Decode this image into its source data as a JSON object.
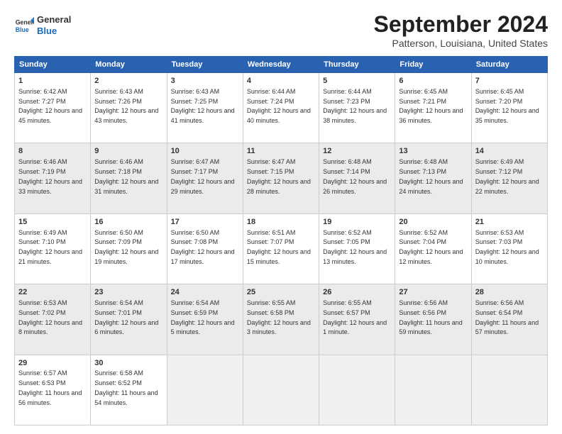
{
  "header": {
    "logo": {
      "general": "General",
      "blue": "Blue"
    },
    "title": "September 2024",
    "subtitle": "Patterson, Louisiana, United States"
  },
  "calendar": {
    "days_of_week": [
      "Sunday",
      "Monday",
      "Tuesday",
      "Wednesday",
      "Thursday",
      "Friday",
      "Saturday"
    ],
    "rows": [
      [
        {
          "date": "1",
          "rise": "6:42 AM",
          "set": "7:27 PM",
          "daylight": "12 hours and 45 minutes."
        },
        {
          "date": "2",
          "rise": "6:43 AM",
          "set": "7:26 PM",
          "daylight": "12 hours and 43 minutes."
        },
        {
          "date": "3",
          "rise": "6:43 AM",
          "set": "7:25 PM",
          "daylight": "12 hours and 41 minutes."
        },
        {
          "date": "4",
          "rise": "6:44 AM",
          "set": "7:24 PM",
          "daylight": "12 hours and 40 minutes."
        },
        {
          "date": "5",
          "rise": "6:44 AM",
          "set": "7:23 PM",
          "daylight": "12 hours and 38 minutes."
        },
        {
          "date": "6",
          "rise": "6:45 AM",
          "set": "7:21 PM",
          "daylight": "12 hours and 36 minutes."
        },
        {
          "date": "7",
          "rise": "6:45 AM",
          "set": "7:20 PM",
          "daylight": "12 hours and 35 minutes."
        }
      ],
      [
        {
          "date": "8",
          "rise": "6:46 AM",
          "set": "7:19 PM",
          "daylight": "12 hours and 33 minutes."
        },
        {
          "date": "9",
          "rise": "6:46 AM",
          "set": "7:18 PM",
          "daylight": "12 hours and 31 minutes."
        },
        {
          "date": "10",
          "rise": "6:47 AM",
          "set": "7:17 PM",
          "daylight": "12 hours and 29 minutes."
        },
        {
          "date": "11",
          "rise": "6:47 AM",
          "set": "7:15 PM",
          "daylight": "12 hours and 28 minutes."
        },
        {
          "date": "12",
          "rise": "6:48 AM",
          "set": "7:14 PM",
          "daylight": "12 hours and 26 minutes."
        },
        {
          "date": "13",
          "rise": "6:48 AM",
          "set": "7:13 PM",
          "daylight": "12 hours and 24 minutes."
        },
        {
          "date": "14",
          "rise": "6:49 AM",
          "set": "7:12 PM",
          "daylight": "12 hours and 22 minutes."
        }
      ],
      [
        {
          "date": "15",
          "rise": "6:49 AM",
          "set": "7:10 PM",
          "daylight": "12 hours and 21 minutes."
        },
        {
          "date": "16",
          "rise": "6:50 AM",
          "set": "7:09 PM",
          "daylight": "12 hours and 19 minutes."
        },
        {
          "date": "17",
          "rise": "6:50 AM",
          "set": "7:08 PM",
          "daylight": "12 hours and 17 minutes."
        },
        {
          "date": "18",
          "rise": "6:51 AM",
          "set": "7:07 PM",
          "daylight": "12 hours and 15 minutes."
        },
        {
          "date": "19",
          "rise": "6:52 AM",
          "set": "7:05 PM",
          "daylight": "12 hours and 13 minutes."
        },
        {
          "date": "20",
          "rise": "6:52 AM",
          "set": "7:04 PM",
          "daylight": "12 hours and 12 minutes."
        },
        {
          "date": "21",
          "rise": "6:53 AM",
          "set": "7:03 PM",
          "daylight": "12 hours and 10 minutes."
        }
      ],
      [
        {
          "date": "22",
          "rise": "6:53 AM",
          "set": "7:02 PM",
          "daylight": "12 hours and 8 minutes."
        },
        {
          "date": "23",
          "rise": "6:54 AM",
          "set": "7:01 PM",
          "daylight": "12 hours and 6 minutes."
        },
        {
          "date": "24",
          "rise": "6:54 AM",
          "set": "6:59 PM",
          "daylight": "12 hours and 5 minutes."
        },
        {
          "date": "25",
          "rise": "6:55 AM",
          "set": "6:58 PM",
          "daylight": "12 hours and 3 minutes."
        },
        {
          "date": "26",
          "rise": "6:55 AM",
          "set": "6:57 PM",
          "daylight": "12 hours and 1 minute."
        },
        {
          "date": "27",
          "rise": "6:56 AM",
          "set": "6:56 PM",
          "daylight": "11 hours and 59 minutes."
        },
        {
          "date": "28",
          "rise": "6:56 AM",
          "set": "6:54 PM",
          "daylight": "11 hours and 57 minutes."
        }
      ],
      [
        {
          "date": "29",
          "rise": "6:57 AM",
          "set": "6:53 PM",
          "daylight": "11 hours and 56 minutes."
        },
        {
          "date": "30",
          "rise": "6:58 AM",
          "set": "6:52 PM",
          "daylight": "11 hours and 54 minutes."
        },
        null,
        null,
        null,
        null,
        null
      ]
    ]
  }
}
